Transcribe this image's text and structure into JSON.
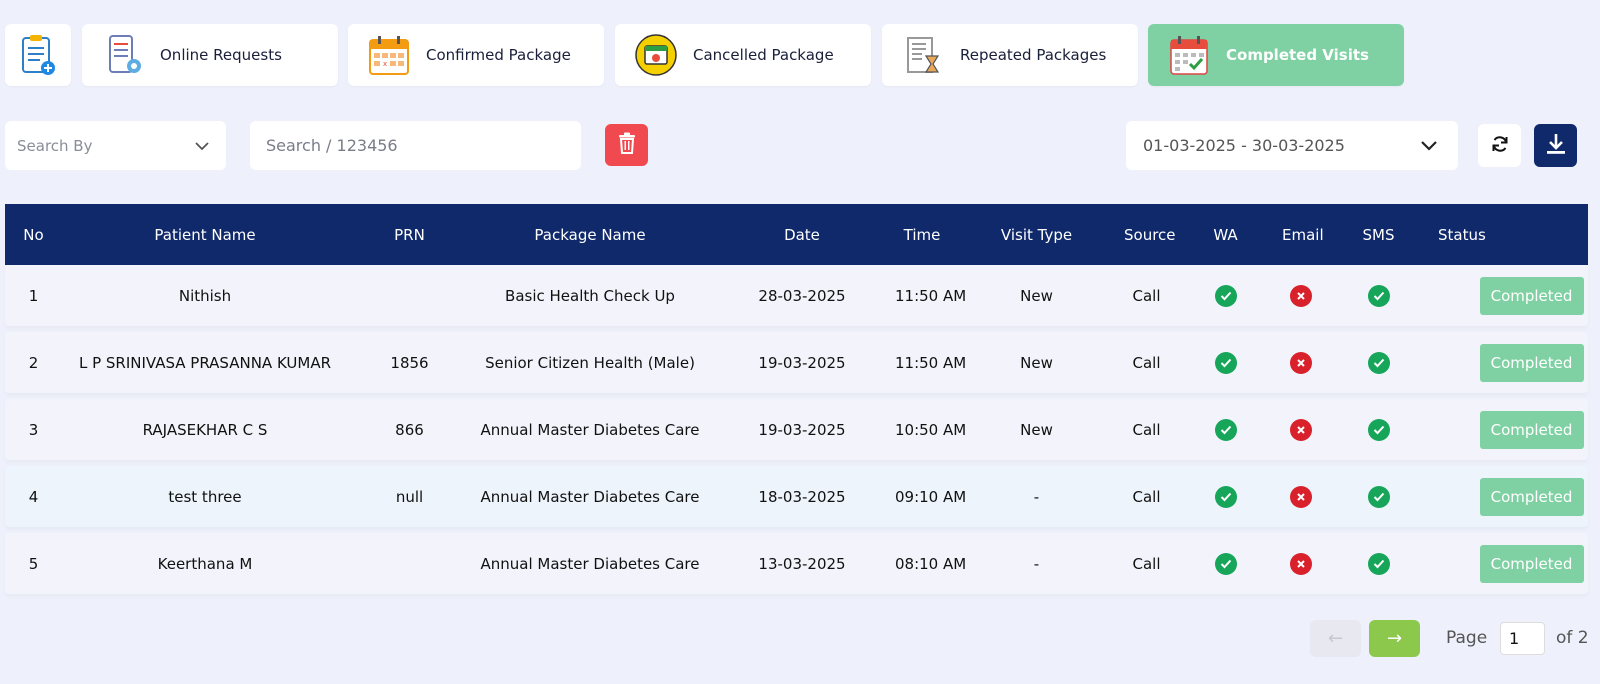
{
  "tabs": [
    {
      "label": "",
      "icon": "clipboard-checklist-icon"
    },
    {
      "label": "Online Requests",
      "icon": "phone-checklist-icon"
    },
    {
      "label": "Confirmed Package",
      "icon": "calendar-icon"
    },
    {
      "label": "Cancelled Package",
      "icon": "calendar-cancel-icon"
    },
    {
      "label": "Repeated Packages",
      "icon": "document-hourglass-icon"
    },
    {
      "label": "Completed Visits",
      "icon": "calendar-check-icon",
      "active": true
    }
  ],
  "filters": {
    "search_by": "Search By",
    "search_placeholder": "Search / 123456",
    "date_range": "01-03-2025 - 30-03-2025"
  },
  "table": {
    "headers": [
      "No",
      "Patient Name",
      "PRN",
      "Package Name",
      "Date",
      "Time",
      "Visit Type",
      "Source",
      "WA",
      "Email",
      "SMS",
      "Status"
    ],
    "rows": [
      {
        "no": "1",
        "name": "Nithish",
        "prn": "",
        "package": "Basic Health Check Up",
        "date": "28-03-2025",
        "time": "11:50 AM",
        "visit": "New",
        "source": "Call",
        "wa": true,
        "email": false,
        "sms": true,
        "status": "Completed"
      },
      {
        "no": "2",
        "name": "L P SRINIVASA PRASANNA KUMAR",
        "prn": "1856",
        "package": "Senior Citizen Health (Male)",
        "date": "19-03-2025",
        "time": "11:50 AM",
        "visit": "New",
        "source": "Call",
        "wa": true,
        "email": false,
        "sms": true,
        "status": "Completed"
      },
      {
        "no": "3",
        "name": "RAJASEKHAR C S",
        "prn": "866",
        "package": "Annual Master Diabetes Care",
        "date": "19-03-2025",
        "time": "10:50 AM",
        "visit": "New",
        "source": "Call",
        "wa": true,
        "email": false,
        "sms": true,
        "status": "Completed"
      },
      {
        "no": "4",
        "name": "test three",
        "prn": "null",
        "package": "Annual Master Diabetes Care",
        "date": "18-03-2025",
        "time": "09:10 AM",
        "visit": "-",
        "source": "Call",
        "wa": true,
        "email": false,
        "sms": true,
        "status": "Completed"
      },
      {
        "no": "5",
        "name": "Keerthana M",
        "prn": "",
        "package": "Annual Master Diabetes Care",
        "date": "13-03-2025",
        "time": "08:10 AM",
        "visit": "-",
        "source": "Call",
        "wa": true,
        "email": false,
        "sms": true,
        "status": "Completed"
      }
    ]
  },
  "pager": {
    "prev": "←",
    "next": "→",
    "page_label": "Page",
    "page": "1",
    "of_label": "of 2"
  },
  "colors": {
    "navy": "#10296b",
    "green": "#7fd1a3",
    "red": "#f0494f",
    "lime": "#8cc84b"
  }
}
